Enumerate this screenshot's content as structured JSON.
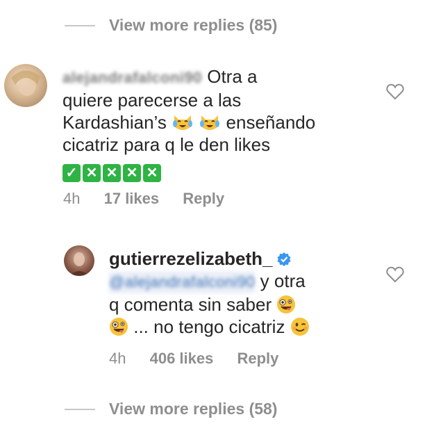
{
  "thread_top": {
    "view_more_label": "View more replies (85)"
  },
  "comment1": {
    "username": "alejandrafalconi90",
    "text_parts": [
      "Otra a",
      "quiere parecerse a las",
      "Kardashian’s",
      "enseñando",
      "cicatriz para q le den likes"
    ],
    "time": "4h",
    "likes": "17 likes",
    "reply_label": "Reply",
    "emojis": [
      "crying-laughing-cat-emoji",
      "crying-laughing-cat-emoji",
      "check-mark-emoji",
      "cross-mark-emoji",
      "cross-mark-emoji",
      "cross-mark-emoji",
      "cross-mark-emoji"
    ]
  },
  "comment2": {
    "username": "gutierrezelizabeth_",
    "mention": "@alejandrafalconi90",
    "text_parts": [
      "y otra",
      "q comenta sin saber",
      "... no tengo cicatriz"
    ],
    "time": "4h",
    "likes": "406 likes",
    "reply_label": "Reply",
    "verified": true,
    "emojis": [
      "zany-face-emoji",
      "zany-face-emoji",
      "winking-face-emoji"
    ]
  },
  "thread_bottom": {
    "view_more_label": "View more replies (58)"
  },
  "colors": {
    "text": "#262626",
    "muted": "#8e8e8e",
    "verified": "#3897f0",
    "check_green": "#2fb344"
  }
}
